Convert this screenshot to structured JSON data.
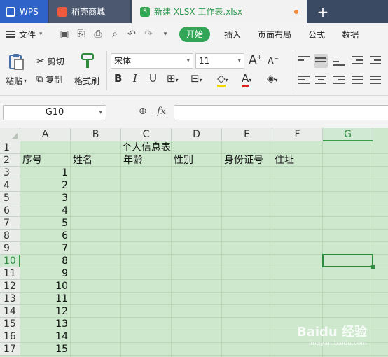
{
  "tabs": [
    {
      "label": "WPS"
    },
    {
      "label": "稻壳商城"
    },
    {
      "label": "新建 XLSX 工作表.xlsx"
    }
  ],
  "menu": {
    "file": "文件",
    "tabs": [
      "开始",
      "插入",
      "页面布局",
      "公式",
      "数据"
    ]
  },
  "ribbon": {
    "paste": "粘贴",
    "cut": "剪切",
    "copy": "复制",
    "format_painter": "格式刷",
    "font_name": "宋体",
    "font_size": "11"
  },
  "formula_bar": {
    "name_box": "G10",
    "fx": "fx",
    "formula": ""
  },
  "sheet": {
    "columns": [
      "A",
      "B",
      "C",
      "D",
      "E",
      "F",
      "G"
    ],
    "selected_column": "G",
    "rows": [
      "1",
      "2",
      "3",
      "4",
      "5",
      "6",
      "7",
      "8",
      "9",
      "10",
      "11",
      "12",
      "13",
      "14",
      "15",
      "16",
      "17"
    ],
    "selected_row": "10",
    "title": "个人信息表",
    "headers": [
      "序号",
      "姓名",
      "年龄",
      "性别",
      "身份证号",
      "住址"
    ],
    "serials": [
      "1",
      "2",
      "3",
      "4",
      "5",
      "6",
      "7",
      "8",
      "9",
      "10",
      "11",
      "12",
      "13",
      "14",
      "15"
    ]
  },
  "watermark": {
    "text": "Baidu 经验",
    "sub": "jingyan.baidu.com"
  }
}
